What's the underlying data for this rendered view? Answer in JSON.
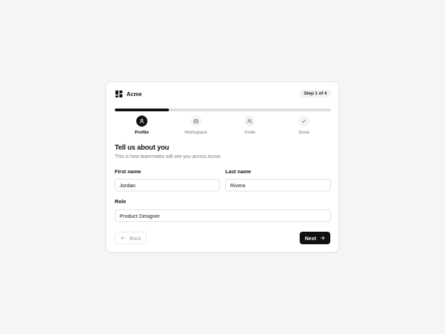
{
  "brand": {
    "name": "Acme",
    "icon": "layout-grid-icon"
  },
  "step_badge": "Step 1 of 4",
  "progress": {
    "fraction": 0.25
  },
  "steps": [
    {
      "label": "Profile",
      "icon": "user-icon",
      "state": "active"
    },
    {
      "label": "Workspace",
      "icon": "briefcase-icon",
      "state": "upcoming"
    },
    {
      "label": "Invite",
      "icon": "users-icon",
      "state": "upcoming"
    },
    {
      "label": "Done",
      "icon": "check-icon",
      "state": "upcoming"
    }
  ],
  "form": {
    "title": "Tell us about you",
    "subtitle": "This is how teammates will see you across Acme.",
    "first_name": {
      "label": "First name",
      "value": "Jordan"
    },
    "last_name": {
      "label": "Last name",
      "value": "Rivera"
    },
    "role": {
      "label": "Role",
      "value": "Product Designer"
    }
  },
  "actions": {
    "back_label": "Back",
    "next_label": "Next"
  },
  "colors": {
    "accent": "#111111",
    "track": "#dddddd",
    "muted_text": "#777777",
    "background": "#f5f5f5"
  }
}
